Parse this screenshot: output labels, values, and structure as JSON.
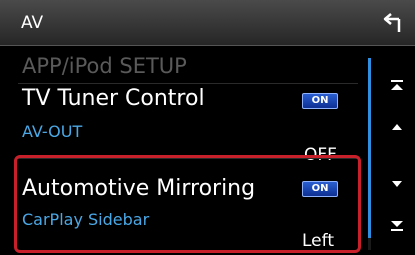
{
  "header": {
    "title": "AV",
    "back_icon": "back-arrow-icon"
  },
  "list": {
    "items": [
      {
        "label": "APP/iPod SETUP"
      },
      {
        "label": "TV Tuner Control",
        "badge": "ON"
      },
      {
        "label": "AV-OUT",
        "value": "OFF"
      },
      {
        "label": "Automotive Mirroring",
        "badge": "ON"
      },
      {
        "label": "CarPlay Sidebar",
        "value": "Left"
      }
    ]
  },
  "scroll": {
    "top_icon": "scroll-to-top-icon",
    "up_icon": "scroll-up-icon",
    "down_icon": "scroll-down-icon",
    "bottom_icon": "scroll-to-bottom-icon"
  },
  "colors": {
    "header_top": "#4a4a4a",
    "sub_label": "#4aa8e6",
    "badge_blue": "#1f4fc0",
    "highlight_border": "#c8202a",
    "scrollbar": "#2f8fe0"
  }
}
